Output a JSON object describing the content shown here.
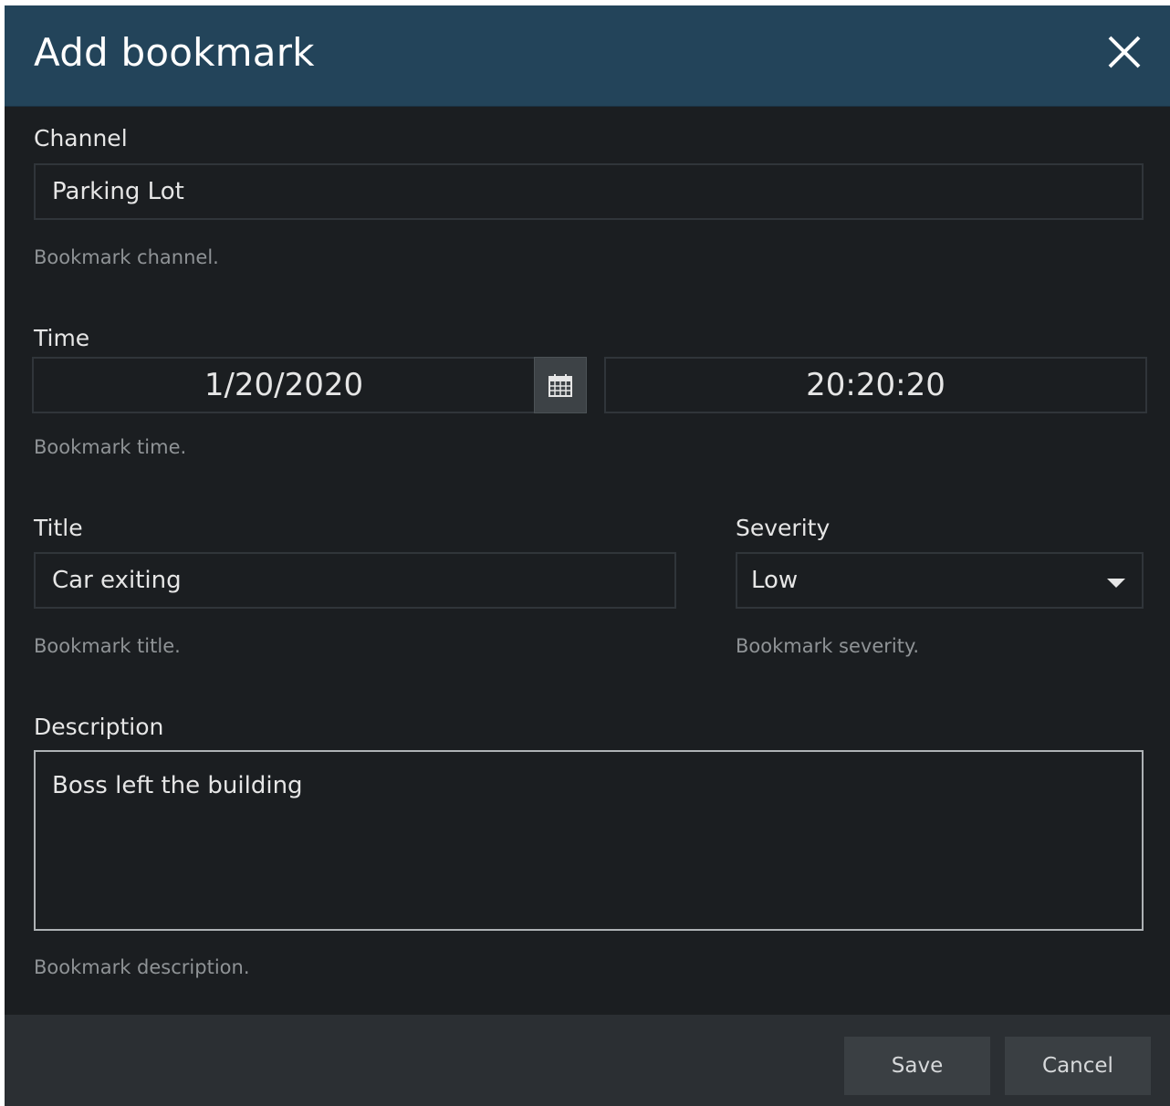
{
  "dialog": {
    "title": "Add bookmark",
    "close_icon": "close-icon"
  },
  "channel": {
    "label": "Channel",
    "value": "Parking Lot",
    "hint": "Bookmark channel."
  },
  "time": {
    "label": "Time",
    "date_value": "1/20/2020",
    "calendar_icon": "calendar-icon",
    "time_value": "20:20:20",
    "hint": "Bookmark time."
  },
  "title_field": {
    "label": "Title",
    "value": "Car exiting",
    "hint": "Bookmark title."
  },
  "severity": {
    "label": "Severity",
    "selected": "Low",
    "dropdown_icon": "caret-down-icon",
    "hint": "Bookmark severity."
  },
  "description": {
    "label": "Description",
    "value": "Boss left the building",
    "hint": "Bookmark description."
  },
  "footer": {
    "save_label": "Save",
    "cancel_label": "Cancel"
  },
  "colors": {
    "header_bg": "#23445a",
    "dialog_bg": "#1b1e21",
    "footer_bg": "#2b2f33",
    "button_bg": "#3a3f43"
  }
}
